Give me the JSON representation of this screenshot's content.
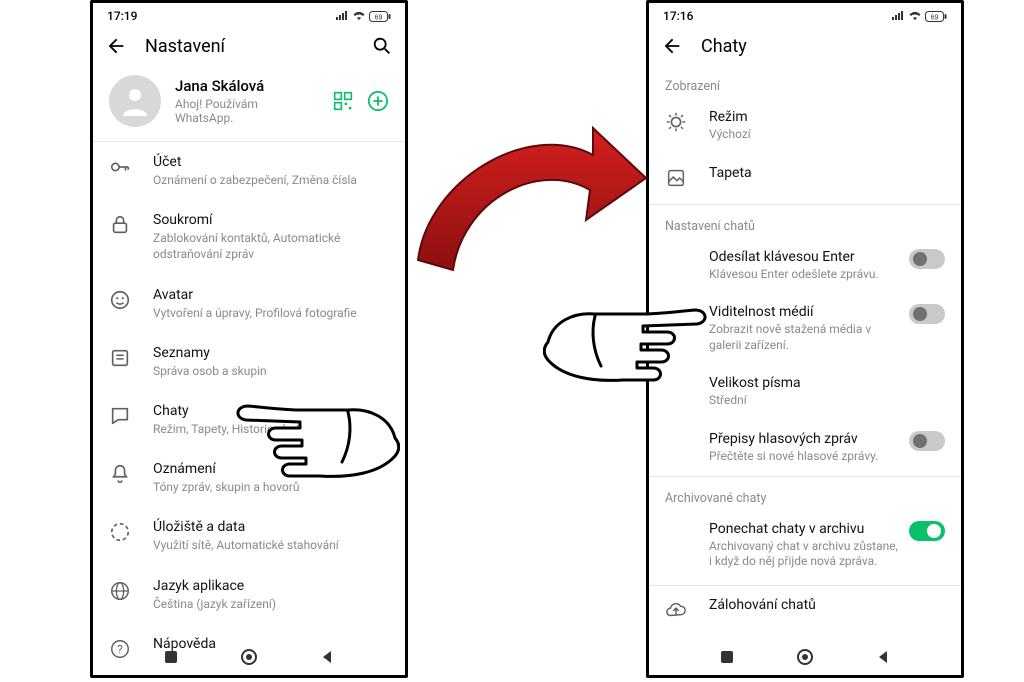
{
  "left": {
    "status_time": "17:19",
    "title": "Nastavení",
    "profile": {
      "name": "Jana Skálová",
      "status": "Ahoj! Používám WhatsApp."
    },
    "items": {
      "account": {
        "title": "Účet",
        "sub": "Oznámení o zabezpečení, Změna čísla"
      },
      "privacy": {
        "title": "Soukromí",
        "sub": "Zablokování kontaktů, Automatické odstraňování zpráv"
      },
      "avatar": {
        "title": "Avatar",
        "sub": "Vytvoření a úpravy, Profilová fotografie"
      },
      "lists": {
        "title": "Seznamy",
        "sub": "Správa osob a skupin"
      },
      "chats": {
        "title": "Chaty",
        "sub": "Režim, Tapety, Historie chatů"
      },
      "notif": {
        "title": "Oznámení",
        "sub": "Tóny zpráv, skupin a hovorů"
      },
      "storage": {
        "title": "Úložiště a data",
        "sub": "Využití sítě, Automatické stahování"
      },
      "lang": {
        "title": "Jazyk aplikace",
        "sub": "Čeština (jazyk zařízení)"
      },
      "help": {
        "title": "Nápověda"
      }
    }
  },
  "right": {
    "status_time": "17:16",
    "title": "Chaty",
    "sections": {
      "display": "Zobrazení",
      "chat_settings": "Nastavení chatů",
      "archived": "Archivované chaty"
    },
    "items": {
      "theme": {
        "title": "Režim",
        "sub": "Výchozí"
      },
      "wallpaper": {
        "title": "Tapeta"
      },
      "enter_send": {
        "title": "Odesílat klávesou Enter",
        "sub": "Klávesou Enter odešlete zprávu."
      },
      "media_vis": {
        "title": "Viditelnost médií",
        "sub": "Zobrazit nově stažená média v galerii zařízení."
      },
      "font_size": {
        "title": "Velikost písma",
        "sub": "Střední"
      },
      "transcripts": {
        "title": "Přepisy hlasových zpráv",
        "sub": "Přečtěte si nové hlasové zprávy."
      },
      "keep_archived": {
        "title": "Ponechat chaty v archivu",
        "sub": "Archivovaný chat v archivu zůstane, i když do něj přijde nová zpráva."
      },
      "backup": {
        "title": "Zálohování chatů"
      }
    }
  }
}
